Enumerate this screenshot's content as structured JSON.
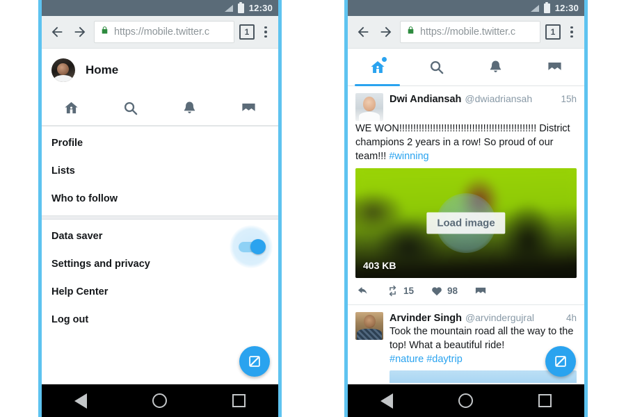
{
  "status_bar": {
    "time": "12:30",
    "signal_icon": "signal-icon",
    "battery_icon": "battery-icon"
  },
  "browser": {
    "back_icon": "back-arrow-icon",
    "forward_icon": "forward-arrow-icon",
    "lock_icon": "lock-icon",
    "url": "https://mobile.twitter.c",
    "tab_count": "1",
    "menu_icon": "overflow-menu-icon"
  },
  "left_phone": {
    "account": {
      "title": "Home",
      "avatar": "user-avatar"
    },
    "tabs": [
      {
        "name": "home",
        "icon": "home-icon",
        "active": false
      },
      {
        "name": "search",
        "icon": "search-icon",
        "active": false
      },
      {
        "name": "notifications",
        "icon": "bell-icon",
        "active": false
      },
      {
        "name": "messages",
        "icon": "envelope-icon",
        "active": false
      }
    ],
    "menu_group_1": [
      {
        "label": "Profile"
      },
      {
        "label": "Lists"
      },
      {
        "label": "Who to follow"
      }
    ],
    "menu_group_2": [
      {
        "label": "Data saver",
        "toggle": true,
        "toggle_on": true
      },
      {
        "label": "Settings and privacy",
        "toggle": false
      },
      {
        "label": "Help Center",
        "toggle": false
      },
      {
        "label": "Log out",
        "toggle": false
      }
    ],
    "compose_fab": "compose-tweet-icon"
  },
  "right_phone": {
    "tabs": [
      {
        "name": "home",
        "icon": "home-icon",
        "active": true,
        "badge": true
      },
      {
        "name": "search",
        "icon": "search-icon",
        "active": false,
        "badge": false
      },
      {
        "name": "notifications",
        "icon": "bell-icon",
        "active": false,
        "badge": false
      },
      {
        "name": "messages",
        "icon": "envelope-icon",
        "active": false,
        "badge": false
      }
    ],
    "tweets": [
      {
        "name": "Dwi Andiansah",
        "handle": "@dwiadriansah",
        "time": "15h",
        "text_line1": "WE WON!!!!!!!!!!!!!!!!!!!!!!!!!!!!!!!!!!!!!!!!!!!!!!!!!",
        "text_line2": "District champions 2 years in a row! So proud of our team!!!",
        "hashtag": "#winning",
        "media": {
          "load_label": "Load image",
          "size_label": "403 KB"
        },
        "actions": {
          "reply_icon": "reply-icon",
          "retweet_icon": "retweet-icon",
          "retweet_count": "15",
          "like_icon": "heart-icon",
          "like_count": "98",
          "dm_icon": "envelope-icon"
        }
      },
      {
        "name": "Arvinder Singh",
        "handle": "@arvindergujral",
        "time": "4h",
        "text_line1": "Took the mountain road all the way to the",
        "text_line2": "top! What a beautiful ride!",
        "hashtag": "#nature #daytrip"
      }
    ],
    "compose_fab": "compose-tweet-icon"
  },
  "nav_bar": {
    "back": "back-triangle-icon",
    "home": "home-circle-icon",
    "recents": "recents-square-icon"
  },
  "colors": {
    "accent": "#2aa3ef",
    "frame": "#5ec3f0",
    "status_bar": "#5a6b78",
    "muted_text": "#8899a6"
  }
}
